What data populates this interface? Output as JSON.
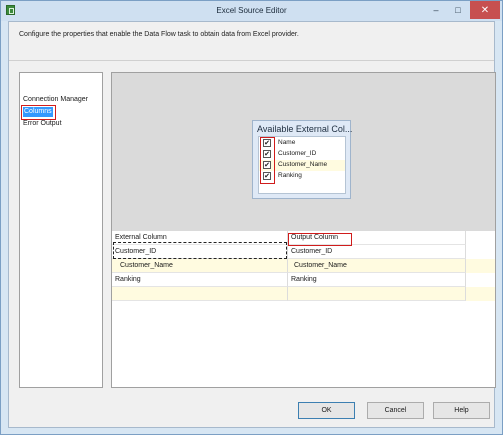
{
  "window": {
    "title": "Excel Source Editor",
    "minimize_glyph": "–",
    "maximize_glyph": "□",
    "close_glyph": "✕"
  },
  "description": "Configure the properties that enable the Data Flow task to obtain data from Excel provider.",
  "nav": {
    "items": [
      {
        "label": "Connection Manager",
        "selected": false
      },
      {
        "label": "Columns",
        "selected": true
      },
      {
        "label": "Error Output",
        "selected": false
      }
    ]
  },
  "external_columns_box": {
    "title": "Available External Col...",
    "items": [
      {
        "label": "Name",
        "checked": true,
        "check_glyph": "✔"
      },
      {
        "label": "Customer_ID",
        "checked": true,
        "check_glyph": "✔"
      },
      {
        "label": "Customer_Name",
        "checked": true,
        "check_glyph": "✔"
      },
      {
        "label": "Ranking",
        "checked": true,
        "check_glyph": "✔"
      }
    ]
  },
  "mapping_grid": {
    "headers": {
      "external": "External Column",
      "output": "Output Column"
    },
    "rows": [
      {
        "external": "Customer_ID",
        "output": "Customer_ID"
      },
      {
        "external": "Customer_Name",
        "output": "Customer_Name"
      },
      {
        "external": "Ranking",
        "output": "Ranking"
      },
      {
        "external": "",
        "output": ""
      }
    ]
  },
  "buttons": {
    "ok": "OK",
    "cancel": "Cancel",
    "help": "Help"
  },
  "colors": {
    "highlight": "#d01c1c",
    "selection": "#3399ff",
    "alt_row": "#fffbe0",
    "close_button": "#c75050"
  },
  "icons": {
    "app": "excel-source-icon",
    "checkbox": "checkbox-checked-icon"
  }
}
